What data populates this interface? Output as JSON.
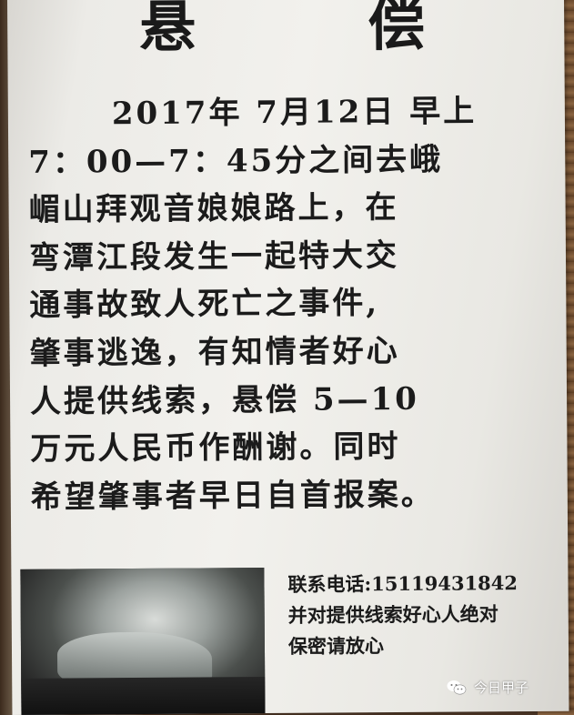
{
  "notice": {
    "title": "悬 偿",
    "body_lines": [
      "2017年 7月12日 早上",
      "7：00—7：45分之间去峨",
      "嵋山拜观音娘娘路上，在",
      "弯潭江段发生一起特大交",
      "通事故致人死亡之事件,",
      "肇事逃逸，有知情者好心",
      "人提供线索，悬偿 5—10",
      "万元人民币作酬谢。同时",
      "希望肇事者早日自首报案。"
    ],
    "contact_lines": [
      "联系电话:15119431842",
      "并对提供线索好心人绝对",
      "保密请放心"
    ]
  },
  "watermark": {
    "text": "今日甲子",
    "icon": "wechat-icon"
  },
  "colors": {
    "paper": "#efeeea",
    "ink": "#1b1b1b",
    "background_wood": "#6b4a2e"
  }
}
